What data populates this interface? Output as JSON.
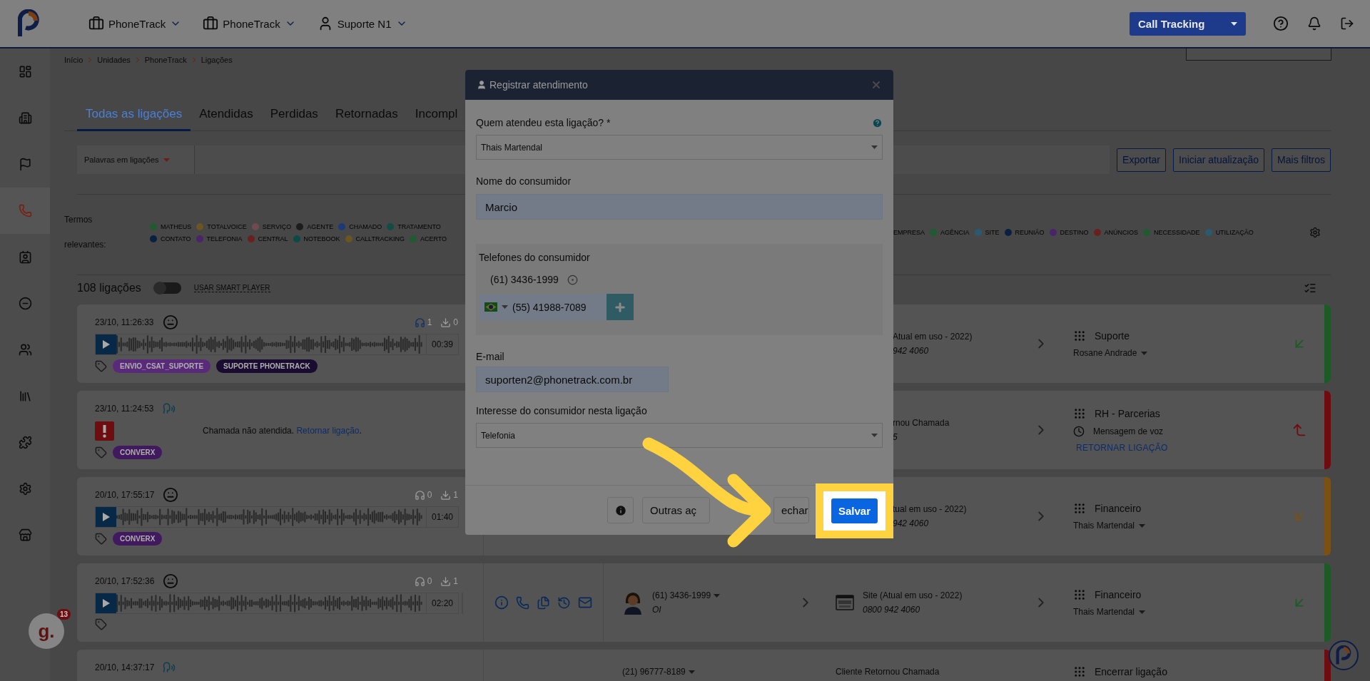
{
  "topbar": {
    "menus": [
      {
        "label": "PhoneTrack",
        "kind": "unit"
      },
      {
        "label": "PhoneTrack",
        "kind": "unit"
      },
      {
        "label": "Suporte N1",
        "kind": "user"
      }
    ],
    "product_select": "Call Tracking"
  },
  "sidebar": {
    "items": [
      {
        "selected": false
      },
      {
        "selected": false
      },
      {
        "selected": false
      },
      {
        "selected": true
      },
      {
        "selected": false
      },
      {
        "selected": false
      },
      {
        "selected": false
      },
      {
        "selected": false
      },
      {
        "selected": false
      },
      {
        "selected": false
      },
      {
        "selected": false
      }
    ]
  },
  "breadcrumb": [
    "Início",
    "Unidades",
    "PhoneTrack",
    "Ligações"
  ],
  "tabs": [
    {
      "label": "Todas as ligações",
      "selected": true
    },
    {
      "label": "Atendidas",
      "selected": false
    },
    {
      "label": "Perdidas",
      "selected": false
    },
    {
      "label": "Retornadas",
      "selected": false
    },
    {
      "label": "Incompl",
      "selected": false
    }
  ],
  "filter": {
    "keyword_select": "Palavras em ligações",
    "buttons": [
      "Exportar",
      "Iniciar atualização",
      "Mais filtros"
    ]
  },
  "terms": {
    "label": "Termos relevantes:",
    "left_rows": [
      [
        {
          "label": "MATHEUS",
          "color": "#1f5a30"
        },
        {
          "label": "TOTALVOICE",
          "color": "#6b5520"
        },
        {
          "label": "SERVIÇO",
          "color": "#704a52"
        },
        {
          "label": "AGENTE",
          "color": "#1c1c1c"
        },
        {
          "label": "CHAMADO",
          "color": "#1c3a78"
        },
        {
          "label": "TRATAMENTO",
          "color": "#0f4d45"
        }
      ],
      [
        {
          "label": "CONTATO",
          "color": "#0a2040"
        },
        {
          "label": "TELEFONIA",
          "color": "#4a2468"
        },
        {
          "label": "CENTRAL",
          "color": "#6b2020"
        },
        {
          "label": "NOTEBOOK",
          "color": "#0c4a45"
        },
        {
          "label": "CALLTRACKING",
          "color": "#6b5520"
        },
        {
          "label": "ACERTO",
          "color": "#1f5a30"
        }
      ]
    ],
    "right_rows": [
      [
        {
          "label": "EMPRESA"
        },
        {
          "label": "AGÊNCIA",
          "color": "#1f5a30"
        },
        {
          "label": "SITE",
          "color": "#2a5a70"
        },
        {
          "label": "REUNIÃO",
          "color": "#0a2040"
        },
        {
          "label": "DESTINO",
          "color": "#4a2468"
        },
        {
          "label": "ANÚNCIOS",
          "color": "#6b2020"
        },
        {
          "label": "NECESSIDADE",
          "color": "#1f5a30"
        },
        {
          "label": "UTILIZAÇÃO",
          "color": "#2a5a70"
        }
      ]
    ]
  },
  "list_header": {
    "count": "108 ligações",
    "smart_player": {
      "label": "USAR SMART PLAYER",
      "on": false
    }
  },
  "calls": [
    {
      "kind": "recorded",
      "datetime": "23/10, 11:26:33",
      "listens": "1",
      "downloads": "0",
      "listened": true,
      "duration": "00:39",
      "tags": [
        {
          "label": "ENVIO_CSAT_SUPORTE",
          "color": "#5a2a7a"
        },
        {
          "label": "SUPORTE PHONETRACK",
          "color": "#1a0c30"
        }
      ],
      "source": {
        "name": "Atual em uso - 2022)",
        "number": "942 4060"
      },
      "department": "Suporte",
      "agent": "Rosane Andrade",
      "color": "#1c5a26"
    },
    {
      "kind": "missed",
      "datetime": "23/10, 11:24:53",
      "message": "Chamada não atendida.",
      "link": "Retornar ligação",
      "message_end": ".",
      "tags": [
        {
          "label": "CONVERX",
          "color": "#40195e"
        }
      ],
      "source": {
        "name": "rnou Chamada",
        "number": "5"
      },
      "department": "RH - Parcerias",
      "status": "Mensagem de voz",
      "action": "RETORNAR LIGAÇÃO",
      "color": "#6e0c10"
    },
    {
      "kind": "recorded",
      "datetime": "20/10, 17:55:17",
      "listens": "0",
      "downloads": "1",
      "listened": false,
      "duration": "01:40",
      "tags": [
        {
          "label": "CONVERX",
          "color": "#40195e"
        }
      ],
      "source": {
        "name": "tual em uso - 2022)",
        "number": "942 4060"
      },
      "department": "Financeiro",
      "agent": "Thais Martendal",
      "color": "#7a5112"
    },
    {
      "kind": "recorded",
      "datetime": "20/10, 17:52:36",
      "listens": "0",
      "downloads": "1",
      "listened": false,
      "duration": "02:20",
      "meter": true,
      "contact": {
        "phone": "(61) 3436-1999",
        "carrier": "OI"
      },
      "source": {
        "kind": "site",
        "name": "Site (Atual em uso - 2022)",
        "number": "0800 942 4060"
      },
      "department": "Financeiro",
      "agent": "Thais Martendal",
      "color": "#1c5a26"
    },
    {
      "kind": "missed",
      "datetime": "20/10, 14:37:17",
      "contact": {
        "phone": "(21) 96777-8189"
      },
      "source": {
        "name": "Cliente Retornou Chamada"
      },
      "department": "Encerrar ligação",
      "color": "#6e0c10"
    }
  ],
  "chat_badge": {
    "letter": "g.",
    "count": "13"
  },
  "modal": {
    "title": "Registrar atendimento",
    "answered_by": {
      "label": "Quem atendeu esta ligação? *",
      "value": "Thais Martendal"
    },
    "name": {
      "label": "Nome do consumidor",
      "value": "Marcio"
    },
    "phones": {
      "label": "Telefones do consumidor",
      "saved": [
        {
          "number": "(61) 3436-1999",
          "selected": true
        }
      ],
      "new_number": "(55) 41988-7089"
    },
    "email": {
      "label": "E-mail",
      "value": "suporten2@phonetrack.com.br"
    },
    "interest": {
      "label": "Interesse do consumidor nesta ligação",
      "value": "Telefonia"
    },
    "footer": {
      "other_actions": "Outras aç",
      "close": "echar",
      "save": "Salvar"
    }
  }
}
